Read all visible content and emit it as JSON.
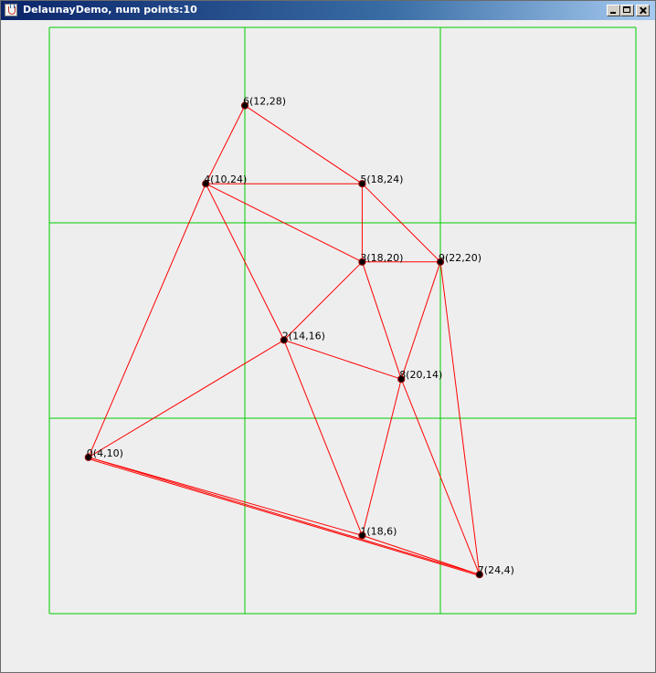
{
  "window": {
    "title": "DelaunayDemo, num points:10",
    "controls": {
      "minimize": "minimize-icon",
      "maximize": "maximize-icon",
      "close": "close-icon"
    }
  },
  "colors": {
    "grid": "#00cc00",
    "edges": "#ff0000",
    "point_fill": "#000000",
    "point_stroke": "#8b0000"
  },
  "points": [
    {
      "id": "0",
      "x": 4,
      "y": 10,
      "label": "0(4,10)"
    },
    {
      "id": "1",
      "x": 18,
      "y": 6,
      "label": "1(18,6)"
    },
    {
      "id": "2",
      "x": 14,
      "y": 16,
      "label": "2(14,16)"
    },
    {
      "id": "3",
      "x": 18,
      "y": 20,
      "label": "3(18,20)"
    },
    {
      "id": "4",
      "x": 10,
      "y": 24,
      "label": "4(10,24)"
    },
    {
      "id": "5",
      "x": 18,
      "y": 24,
      "label": "5(18,24)"
    },
    {
      "id": "6",
      "x": 12,
      "y": 28,
      "label": "6(12,28)"
    },
    {
      "id": "7",
      "x": 24,
      "y": 4,
      "label": "7(24,4)"
    },
    {
      "id": "8",
      "x": 20,
      "y": 14,
      "label": "8(20,14)"
    },
    {
      "id": "9",
      "x": 22,
      "y": 20,
      "label": "9(22,20)"
    }
  ],
  "edges": [
    [
      "6",
      "4"
    ],
    [
      "6",
      "5"
    ],
    [
      "4",
      "5"
    ],
    [
      "4",
      "3"
    ],
    [
      "4",
      "2"
    ],
    [
      "4",
      "0"
    ],
    [
      "5",
      "3"
    ],
    [
      "5",
      "9"
    ],
    [
      "3",
      "9"
    ],
    [
      "3",
      "2"
    ],
    [
      "3",
      "8"
    ],
    [
      "9",
      "8"
    ],
    [
      "9",
      "7"
    ],
    [
      "2",
      "0"
    ],
    [
      "2",
      "8"
    ],
    [
      "2",
      "1"
    ],
    [
      "8",
      "1"
    ],
    [
      "8",
      "7"
    ],
    [
      "0",
      "1"
    ],
    [
      "0",
      "7"
    ],
    [
      "1",
      "7"
    ]
  ],
  "grid": {
    "x_lines": [
      2,
      12,
      22,
      32
    ],
    "y_lines": [
      32,
      22,
      12,
      2
    ]
  }
}
